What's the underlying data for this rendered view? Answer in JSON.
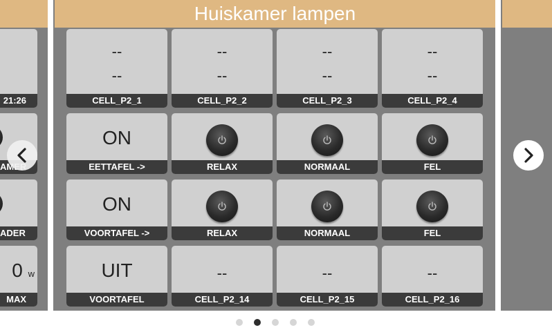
{
  "left_page": {
    "time_label": "21:26",
    "label_2": "AMER",
    "label_3": "ADER",
    "value_4": "0",
    "value_4_unit": "w",
    "label_4": "MAX"
  },
  "main_page": {
    "title": "Huiskamer lampen",
    "rows": [
      [
        {
          "label": "CELL_P2_1",
          "line1": "--",
          "line2": "--"
        },
        {
          "label": "CELL_P2_2",
          "line1": "--",
          "line2": "--"
        },
        {
          "label": "CELL_P2_3",
          "line1": "--",
          "line2": "--"
        },
        {
          "label": "CELL_P2_4",
          "line1": "--",
          "line2": "--"
        }
      ],
      [
        {
          "label": "EETTAFEL ->",
          "state": "ON"
        },
        {
          "label": "RELAX",
          "icon": "power-icon"
        },
        {
          "label": "NORMAAL",
          "icon": "power-icon"
        },
        {
          "label": "FEL",
          "icon": "power-icon"
        }
      ],
      [
        {
          "label": "VOORTAFEL ->",
          "state": "ON"
        },
        {
          "label": "RELAX",
          "icon": "power-icon"
        },
        {
          "label": "NORMAAL",
          "icon": "power-icon"
        },
        {
          "label": "FEL",
          "icon": "power-icon"
        }
      ],
      [
        {
          "label": "VOORTAFEL",
          "state": "UIT"
        },
        {
          "label": "CELL_P2_14",
          "value": "--"
        },
        {
          "label": "CELL_P2_15",
          "value": "--"
        },
        {
          "label": "CELL_P2_16",
          "value": "--"
        }
      ]
    ]
  },
  "nav": {
    "prev_icon": "chevron-left-icon",
    "next_icon": "chevron-right-icon"
  },
  "pager": {
    "count": 5,
    "active_index": 1
  },
  "colors": {
    "header": "#dfb882",
    "background": "#7f7f7f",
    "cell": "#d0d0d0",
    "label_bar": "#3b3b3b"
  }
}
